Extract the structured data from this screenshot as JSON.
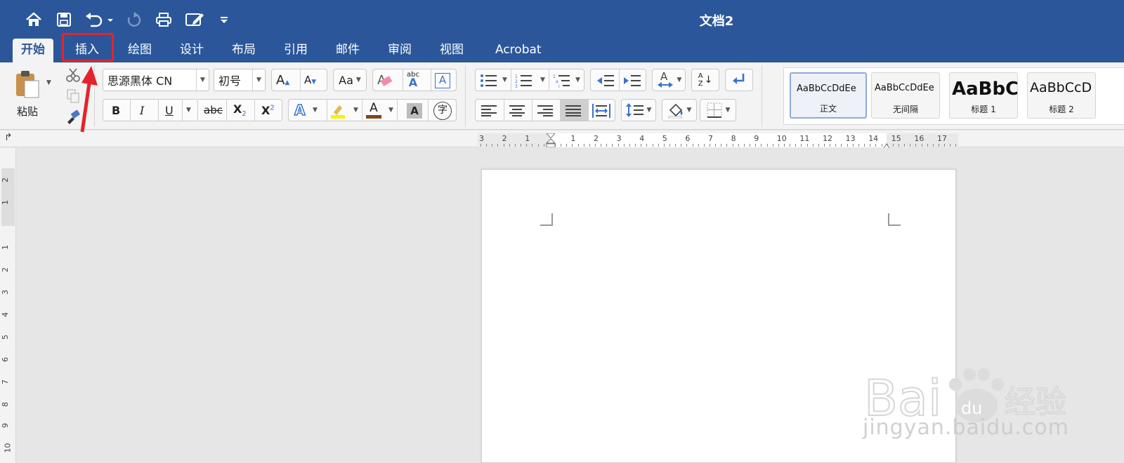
{
  "window": {
    "title": "文档2"
  },
  "quick_access": {
    "icons": [
      "home-icon",
      "save-icon",
      "undo-icon",
      "redo-icon",
      "print-icon",
      "edit-doc-icon",
      "customize-icon"
    ]
  },
  "tabs": [
    {
      "label": "开始",
      "active": true
    },
    {
      "label": "插入",
      "active": false,
      "highlighted": true
    },
    {
      "label": "绘图",
      "active": false
    },
    {
      "label": "设计",
      "active": false
    },
    {
      "label": "布局",
      "active": false
    },
    {
      "label": "引用",
      "active": false
    },
    {
      "label": "邮件",
      "active": false
    },
    {
      "label": "审阅",
      "active": false
    },
    {
      "label": "视图",
      "active": false
    },
    {
      "label": "Acrobat",
      "active": false
    }
  ],
  "ribbon": {
    "paste_label": "粘贴",
    "font_name": "思源黑体 CN",
    "font_size": "初号",
    "format_buttons": {
      "bold": "B",
      "italic": "I",
      "underline": "U",
      "strike": "abc",
      "subscript": "X",
      "superscript": "X",
      "sub_mark": "2",
      "sup_mark": "2"
    },
    "grow_font": "A",
    "shrink_font": "A",
    "change_case": "Aa",
    "clear_format": "A",
    "phonetic": "abc",
    "phonetic_a": "A",
    "char_border": "A",
    "text_effect": "A",
    "font_color": "A",
    "char_shading": "A",
    "enclose_char": "字",
    "sort_a": "A",
    "sort_z": "Z",
    "styles": [
      {
        "sample": "AaBbCcDdEe",
        "name": "正文",
        "selected": true
      },
      {
        "sample": "AaBbCcDdEe",
        "name": "无间隔",
        "selected": false
      },
      {
        "sample": "AaBbC(",
        "name": "标题 1",
        "selected": false
      },
      {
        "sample": "AaBbCcD",
        "name": "标题 2",
        "selected": false
      }
    ]
  },
  "ruler": {
    "horizontal_labels": [
      "3",
      "2",
      "1",
      "1",
      "2",
      "3",
      "4",
      "5",
      "6",
      "7",
      "8",
      "9",
      "10",
      "11",
      "12",
      "13",
      "14",
      "15",
      "16",
      "17"
    ],
    "vertical_labels": [
      "2",
      "1",
      "1",
      "2",
      "3",
      "4",
      "5",
      "6",
      "7",
      "8",
      "9",
      "10"
    ]
  },
  "watermark": {
    "brand": "Bai du 经验",
    "url": "jingyan.baidu.com"
  },
  "colors": {
    "title_bar": "#2b579a",
    "ribbon": "#f3f3f3",
    "highlight": "#e3242b",
    "canvas": "#e6e6e6"
  }
}
